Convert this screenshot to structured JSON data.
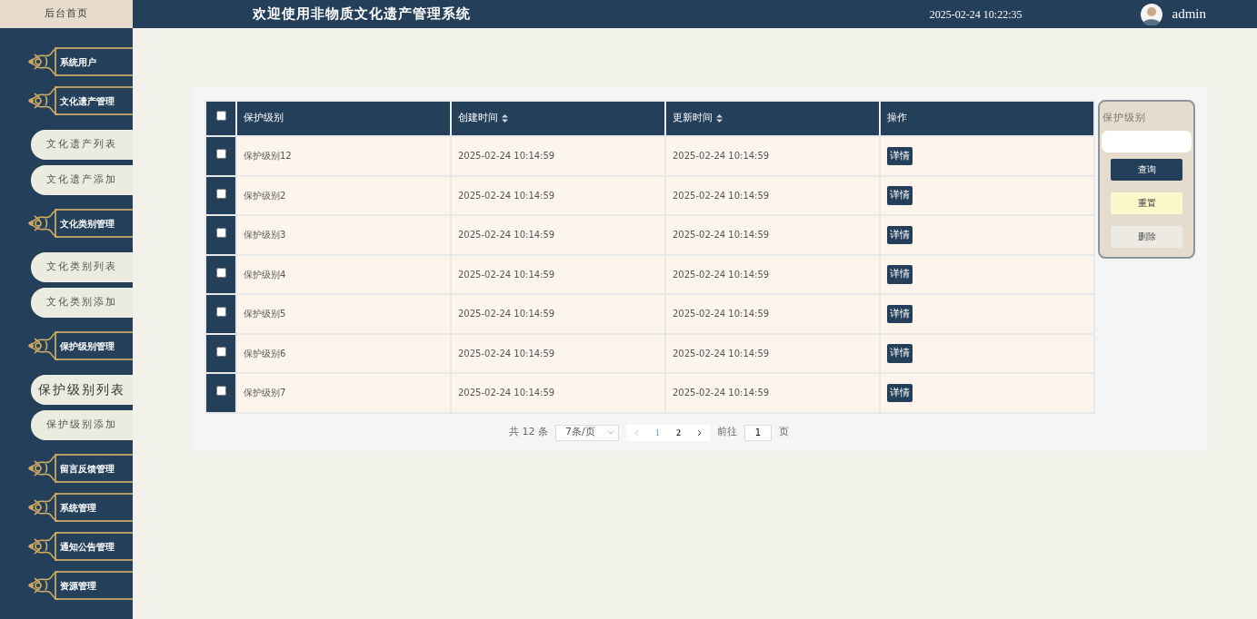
{
  "header": {
    "home_link": "后台首页",
    "title": "欢迎使用非物质文化遗产管理系统",
    "datetime": "2025-02-24 10:22:35",
    "user": "admin"
  },
  "sidebar": [
    {
      "label": "系统用户"
    },
    {
      "label": "文化遗产管理",
      "children": [
        {
          "label": "文化遗产列表",
          "selected": false
        },
        {
          "label": "文化遗产添加",
          "selected": false
        }
      ]
    },
    {
      "label": "文化类别管理",
      "children": [
        {
          "label": "文化类别列表",
          "selected": false
        },
        {
          "label": "文化类别添加",
          "selected": false
        }
      ]
    },
    {
      "label": "保护级别管理",
      "children": [
        {
          "label": "保护级别列表",
          "selected": true
        },
        {
          "label": "保护级别添加",
          "selected": false
        }
      ]
    },
    {
      "label": "留言反馈管理"
    },
    {
      "label": "系统管理"
    },
    {
      "label": "通知公告管理"
    },
    {
      "label": "资源管理"
    }
  ],
  "table": {
    "select_all": {
      "checked": false
    },
    "columns": [
      {
        "label": "保护级别",
        "sortable": false
      },
      {
        "label": "创建时间",
        "sortable": true
      },
      {
        "label": "更新时间",
        "sortable": true
      },
      {
        "label": "操作",
        "sortable": false
      }
    ],
    "rows": [
      {
        "checked": false,
        "level": "保护级别12",
        "created": "2025-02-24 10:14:59",
        "updated": "2025-02-24 10:14:59",
        "action": "详情"
      },
      {
        "checked": false,
        "level": "保护级别2",
        "created": "2025-02-24 10:14:59",
        "updated": "2025-02-24 10:14:59",
        "action": "详情"
      },
      {
        "checked": false,
        "level": "保护级别3",
        "created": "2025-02-24 10:14:59",
        "updated": "2025-02-24 10:14:59",
        "action": "详情"
      },
      {
        "checked": false,
        "level": "保护级别4",
        "created": "2025-02-24 10:14:59",
        "updated": "2025-02-24 10:14:59",
        "action": "详情"
      },
      {
        "checked": false,
        "level": "保护级别5",
        "created": "2025-02-24 10:14:59",
        "updated": "2025-02-24 10:14:59",
        "action": "详情"
      },
      {
        "checked": false,
        "level": "保护级别6",
        "created": "2025-02-24 10:14:59",
        "updated": "2025-02-24 10:14:59",
        "action": "详情"
      },
      {
        "checked": false,
        "level": "保护级别7",
        "created": "2025-02-24 10:14:59",
        "updated": "2025-02-24 10:14:59",
        "action": "详情"
      }
    ]
  },
  "pagination": {
    "total": "共 12 条",
    "page_size": "7条/页",
    "pages": [
      {
        "label": "1",
        "selected": true
      },
      {
        "label": "2",
        "selected": false
      }
    ],
    "goto_label": "前往",
    "goto_value": "1",
    "goto_suffix": "页"
  },
  "search": {
    "label": "保护级别",
    "buttons": [
      {
        "label": "查询",
        "kind": "primary"
      },
      {
        "label": "重置",
        "kind": "reset"
      },
      {
        "label": "删除",
        "kind": "delete"
      }
    ]
  }
}
